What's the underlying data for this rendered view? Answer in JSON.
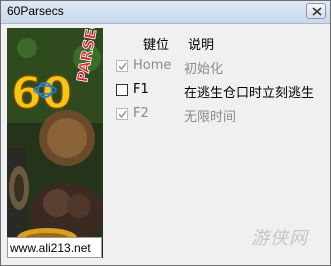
{
  "window": {
    "title": "60Parsecs"
  },
  "table": {
    "col_key": "键位",
    "col_desc": "说明",
    "rows": [
      {
        "key": "Home",
        "desc": "初始化",
        "checked": true,
        "enabled": false
      },
      {
        "key": "F1",
        "desc": "在逃生仓口时立刻逃生",
        "checked": false,
        "enabled": true
      },
      {
        "key": "F2",
        "desc": "无限时间",
        "checked": true,
        "enabled": false
      }
    ]
  },
  "banner": {
    "url": "www.ali213.net",
    "logo_number": "60",
    "logo_word": "PARSECS!"
  },
  "watermark": {
    "text": "游侠网"
  },
  "colors": {
    "title_bar": "#c9d8ec",
    "window_bg": "#f0f0f0",
    "banner_yellow": "#f5c518",
    "banner_red": "#d8262c"
  }
}
